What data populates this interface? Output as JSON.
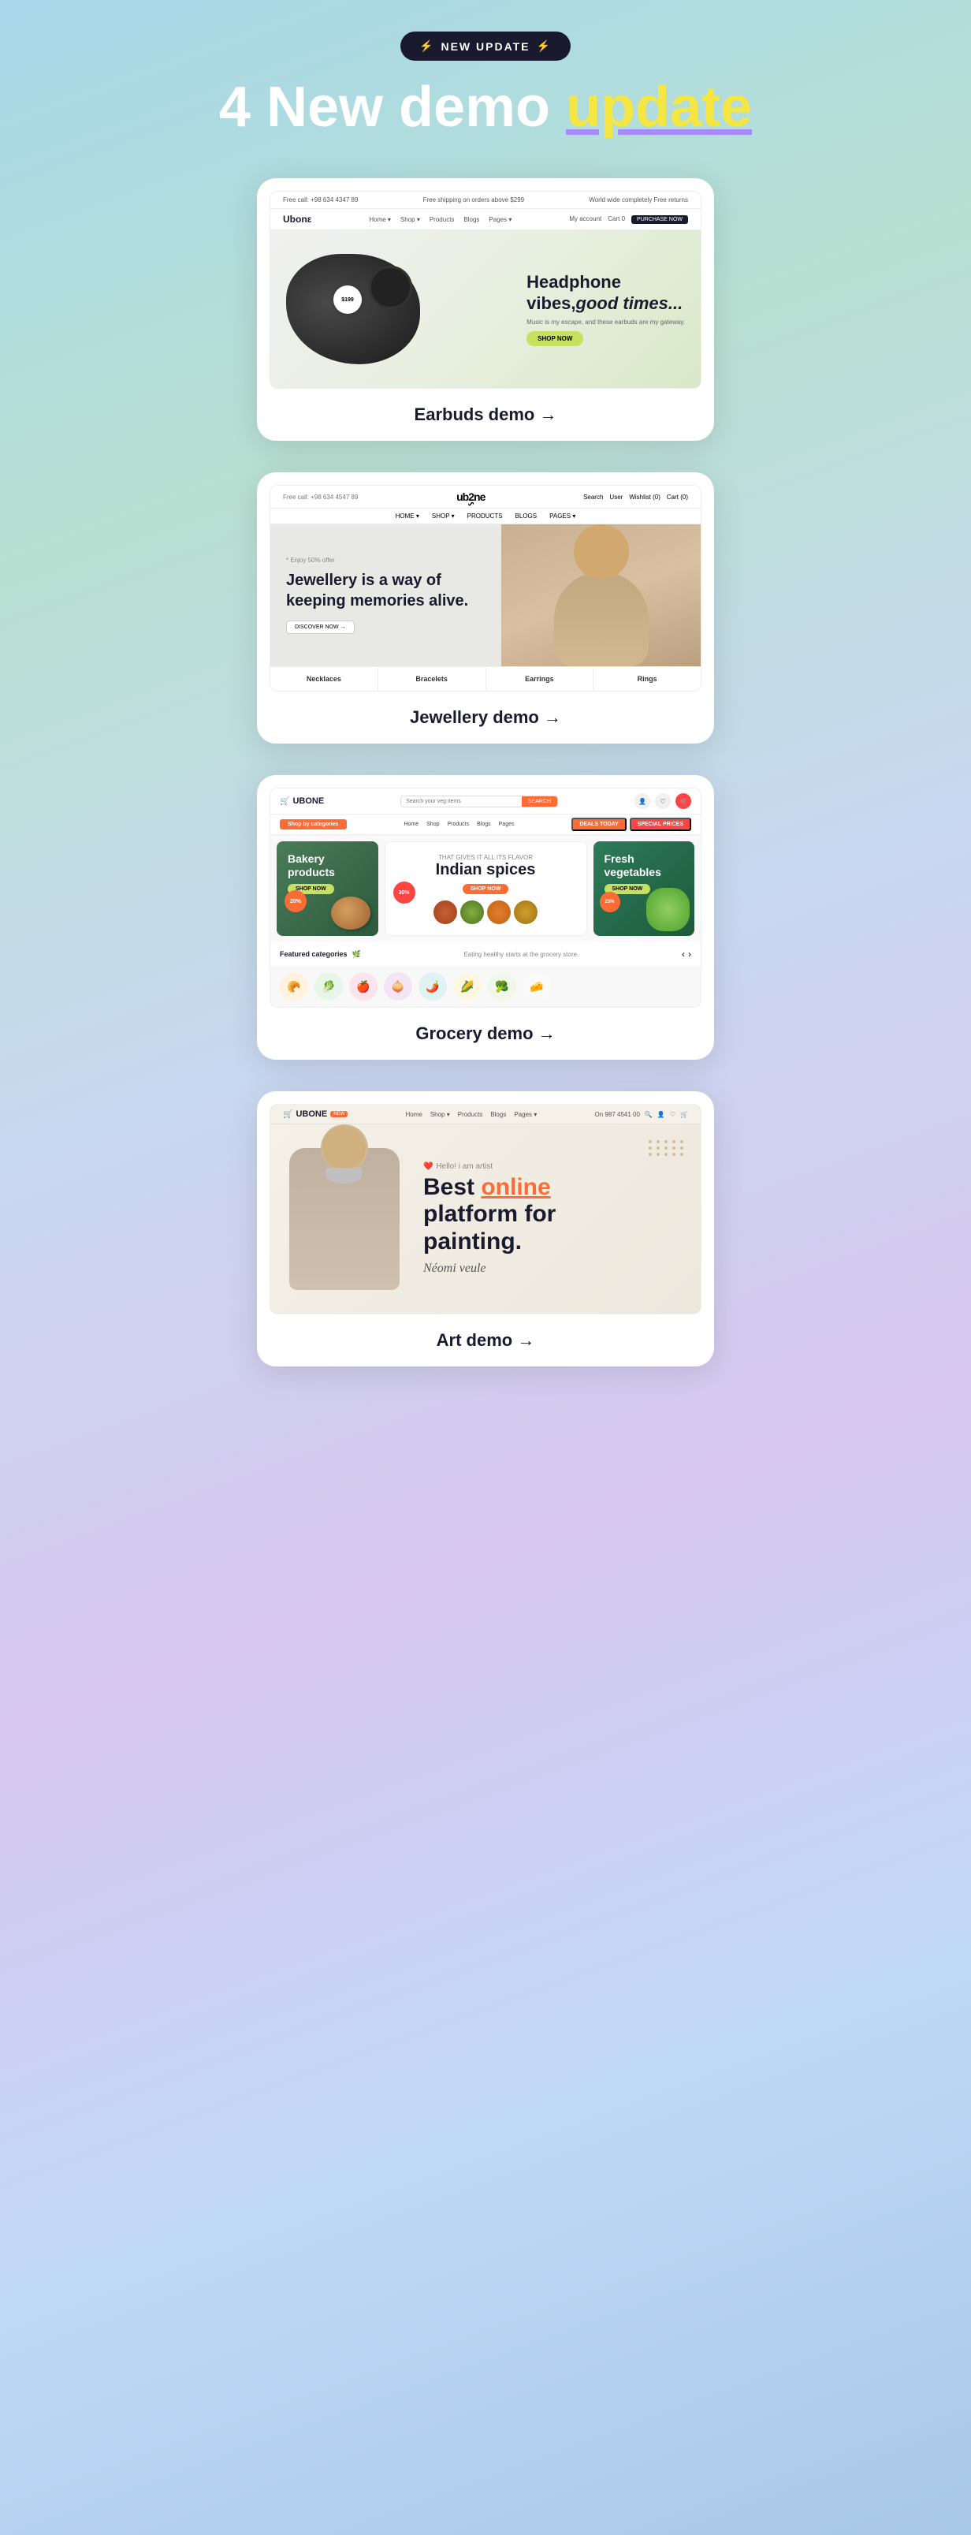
{
  "badge": {
    "bolt1": "⚡",
    "text": "NEW UPDATE",
    "bolt2": "⚡"
  },
  "title": {
    "prefix": "4 New demo ",
    "highlight": "update"
  },
  "earbuds": {
    "label": "Earbuds demo →",
    "price": "$199",
    "heading_line1": "Headphone",
    "heading_line2": "vibes,",
    "heading_bold": "good times...",
    "subtitle": "Music is my escape, and these earbuds are my gateway.",
    "cta": "SHOP NOW",
    "header": {
      "phone": "Free call: +98 634 4347 89",
      "shipping": "Free shipping on orders above $299",
      "returns": "World wide completely Free returns",
      "logo": "Ubonε",
      "nav_items": [
        "Home ▾",
        "Shop ▾",
        "Products",
        "Blogs",
        "Pages ▾"
      ],
      "account": "My account",
      "cart": "Cart 0",
      "purchase": "PURCHASE NOW"
    }
  },
  "jewellery": {
    "label": "Jewellery demo →",
    "offer": "* Enjoy 50% offer",
    "heading": "Jewellery is a way of keeping memories alive.",
    "cta": "DISCOVER NOW →",
    "logo_text": "ub2ne",
    "categories": [
      "Necklaces",
      "Bracelets",
      "Earrings",
      "Rings"
    ]
  },
  "grocery": {
    "label": "Grocery demo →",
    "logo": "UBONE",
    "search_placeholder": "Search your veg items",
    "search_btn": "SEARCH",
    "nav_items": [
      "Home",
      "Shop",
      "Products",
      "Blogs",
      "Pages"
    ],
    "category_dropdown": "Shop by categories",
    "deals_btn": "DEALS TODAY",
    "special_btn": "SPECIAL PRICES",
    "bakery": {
      "title": "Bakery products",
      "cta": "SHOP NOW",
      "discount": "20%"
    },
    "spices": {
      "label": "THAT GIVES IT ALL ITS FLAVOR",
      "title": "Indian spices",
      "cta": "SHOP NOW",
      "discount": "30%"
    },
    "vegetables": {
      "title": "Fresh vegetables",
      "cta": "SHOP NOW",
      "discount": "25%"
    },
    "featured_label": "Featured categories",
    "featured_subtitle": "Eating healthy starts at the grocery store."
  },
  "art": {
    "label": "Art demo →",
    "logo": "UBONE",
    "hello": "Hello! i am artist",
    "title_line1": "Best ",
    "title_highlight": "online",
    "title_line2": "platform for",
    "title_line3": "painting.",
    "signature": "Néomi veule"
  }
}
